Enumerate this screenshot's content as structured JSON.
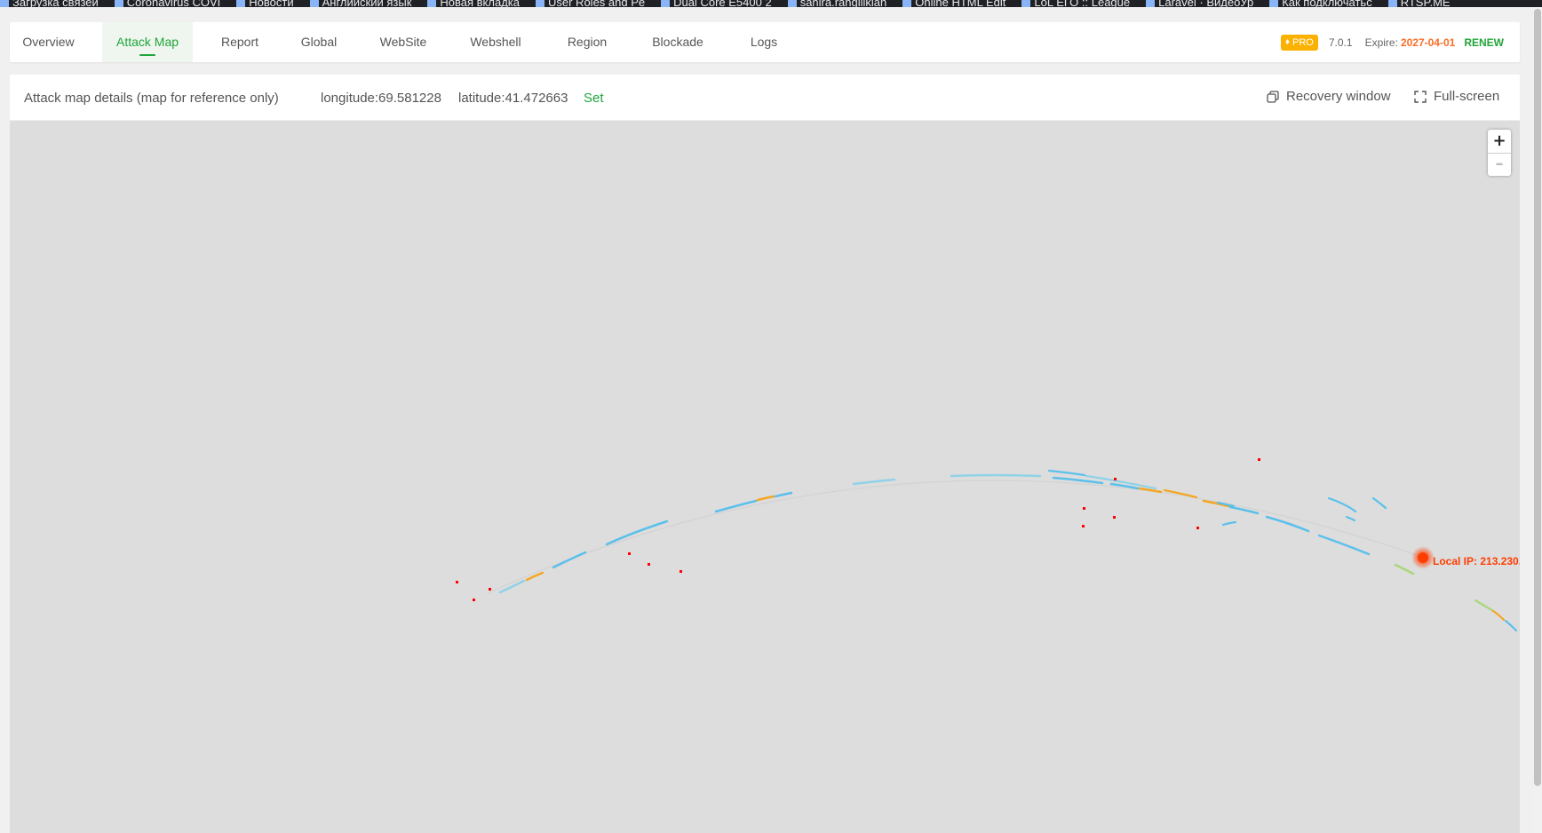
{
  "browser": {
    "bookmarks": [
      "Загрузка связей",
      "Coronavirus COVI",
      "Новости",
      "Английский язык",
      "Новая вкладка",
      "User Roles and Pe",
      "Dual Core E5400 2",
      "sanira.rangilikian",
      "Online HTML Edit",
      "LoL ЕГО :: League",
      "Laravel · ВидеоУр",
      "Как подключатьс",
      "RTSP.ME"
    ]
  },
  "nav": {
    "tabs": [
      {
        "label": "Overview",
        "active": false
      },
      {
        "label": "Attack Map",
        "active": true
      },
      {
        "label": "Report",
        "active": false
      },
      {
        "label": "Global",
        "active": false
      },
      {
        "label": "WebSite",
        "active": false
      },
      {
        "label": "Webshell",
        "active": false
      },
      {
        "label": "Region",
        "active": false
      },
      {
        "label": "Blockade",
        "active": false
      },
      {
        "label": "Logs",
        "active": false
      }
    ],
    "pro_label": "PRO",
    "version": "7.0.1",
    "expire_label": "Expire:",
    "expire_date": "2027-04-01",
    "renew_label": "RENEW"
  },
  "map_panel": {
    "title": "Attack map details (map for reference only)",
    "longitude": "longitude:69.581228",
    "latitude": "latitude:41.472663",
    "set_label": "Set",
    "recovery_label": "Recovery window",
    "fullscreen_label": "Full-screen",
    "zoom_in": "+",
    "zoom_out": "–",
    "local_ip_label": "Local IP: 213.230."
  },
  "colors": {
    "accent": "#20a53a",
    "pro": "#fbb100",
    "expire": "#fc6d26",
    "attack_point": "#ff0000",
    "local_ip": "#ff3d00",
    "line_blue": "#5bc0eb",
    "line_orange": "#f5a623",
    "map_bg": "#dddddd"
  }
}
